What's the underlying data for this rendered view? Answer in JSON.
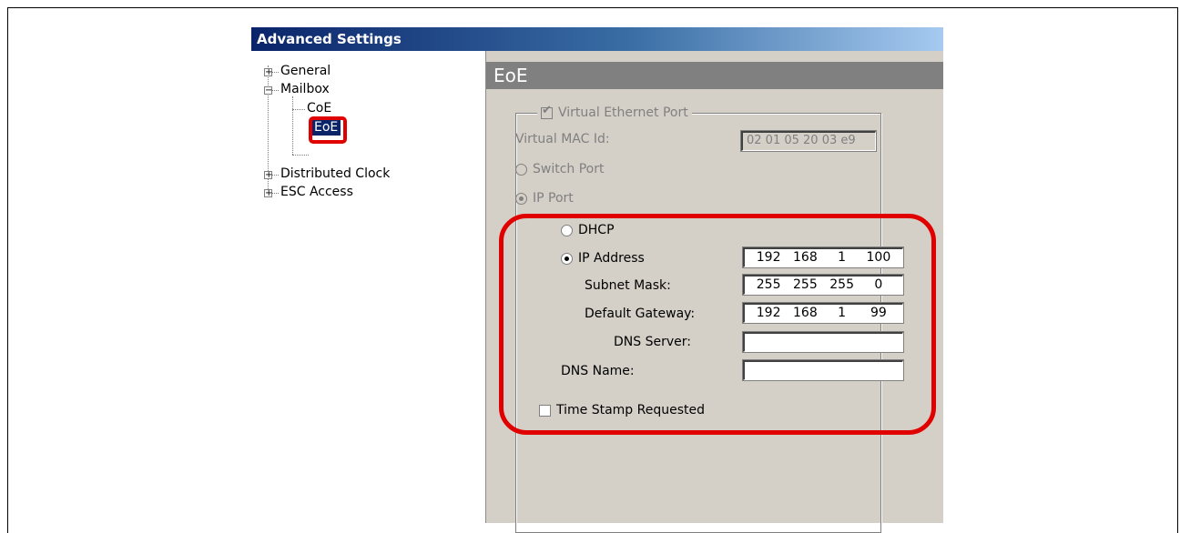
{
  "window": {
    "title": "Advanced Settings"
  },
  "tree": {
    "general": "General",
    "mailbox": "Mailbox",
    "coe": "CoE",
    "eoe": "EoE",
    "distributed_clock": "Distributed Clock",
    "esc_access": "ESC Access",
    "expanded_symbol": "−",
    "collapsed_symbol": "+"
  },
  "panel": {
    "header": "EoE",
    "virtual_ethernet_port": {
      "label": "Virtual Ethernet Port",
      "checked": true,
      "enabled": false
    },
    "virtual_mac": {
      "label": "Virtual MAC Id:",
      "value": "02 01 05 20 03 e9"
    },
    "switch_port": {
      "label": "Switch Port",
      "selected": false
    },
    "ip_port": {
      "label": "IP Port",
      "selected": true
    },
    "dhcp": {
      "label": "DHCP",
      "selected": false
    },
    "ip_address": {
      "label": "IP Address",
      "selected": true,
      "octets": [
        "192",
        "168",
        "1",
        "100"
      ]
    },
    "subnet_mask": {
      "label": "Subnet Mask:",
      "octets": [
        "255",
        "255",
        "255",
        "0"
      ]
    },
    "default_gateway": {
      "label": "Default Gateway:",
      "octets": [
        "192",
        "168",
        "1",
        "99"
      ]
    },
    "dns_server": {
      "label": "DNS Server:",
      "value": ""
    },
    "dns_name": {
      "label": "DNS Name:",
      "value": ""
    },
    "time_stamp": {
      "label": "Time Stamp Requested",
      "checked": false
    }
  },
  "colors": {
    "title_bar": "#0a246a",
    "selection": "#0a246a",
    "highlight_annotation": "#e00000",
    "panel_background": "#d4d0c8",
    "header_background": "#808080"
  }
}
